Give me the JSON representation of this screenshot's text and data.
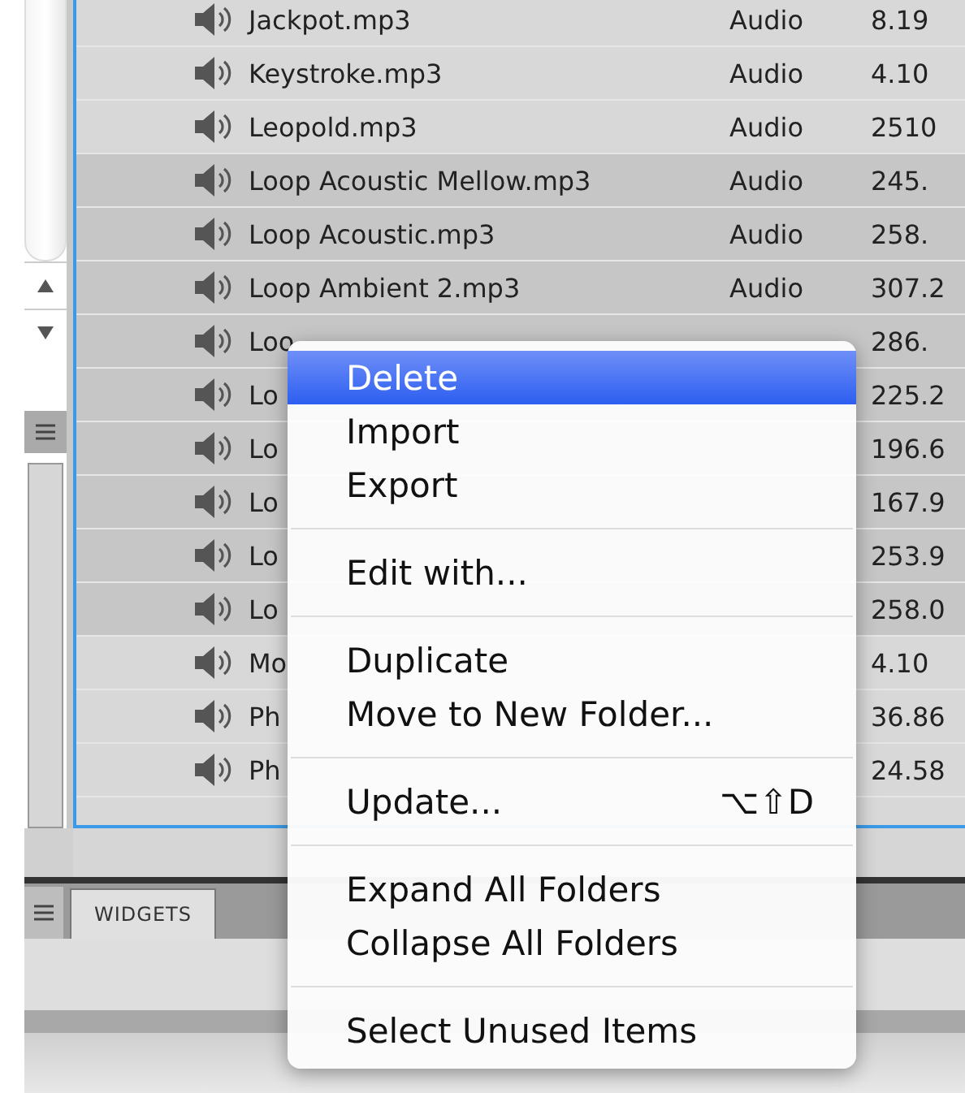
{
  "files": [
    {
      "name": "Jackpot.mp3",
      "type": "Audio",
      "size": "8.19",
      "selected": false
    },
    {
      "name": "Keystroke.mp3",
      "type": "Audio",
      "size": "4.10",
      "selected": false
    },
    {
      "name": "Leopold.mp3",
      "type": "Audio",
      "size": "2510",
      "selected": false
    },
    {
      "name": "Loop Acoustic Mellow.mp3",
      "type": "Audio",
      "size": "245.",
      "selected": true
    },
    {
      "name": "Loop Acoustic.mp3",
      "type": "Audio",
      "size": "258.",
      "selected": true
    },
    {
      "name": "Loop Ambient 2.mp3",
      "type": "Audio",
      "size": "307.2",
      "selected": true
    },
    {
      "name": "Loo",
      "size": "286.",
      "selected": true
    },
    {
      "name": "Lo",
      "size": "225.2",
      "selected": true
    },
    {
      "name": "Lo",
      "size": "196.6",
      "selected": true
    },
    {
      "name": "Lo",
      "size": "167.9",
      "selected": true
    },
    {
      "name": "Lo",
      "size": "253.9",
      "selected": true
    },
    {
      "name": "Lo",
      "size": "258.0",
      "selected": true
    },
    {
      "name": "Mo",
      "size": "4.10",
      "selected": false
    },
    {
      "name": "Ph",
      "size": "36.86",
      "selected": false
    },
    {
      "name": "Ph",
      "size": "24.58",
      "selected": false
    }
  ],
  "context_menu": [
    {
      "kind": "item",
      "label": "Delete",
      "selected": true
    },
    {
      "kind": "item",
      "label": "Import",
      "selected": false
    },
    {
      "kind": "item",
      "label": "Export",
      "selected": false
    },
    {
      "kind": "separator"
    },
    {
      "kind": "item",
      "label": "Edit with...",
      "selected": false
    },
    {
      "kind": "separator"
    },
    {
      "kind": "item",
      "label": "Duplicate",
      "selected": false
    },
    {
      "kind": "item",
      "label": "Move to New Folder...",
      "selected": false
    },
    {
      "kind": "separator"
    },
    {
      "kind": "item",
      "label": "Update...",
      "shortcut": "⌥⇧D",
      "selected": false
    },
    {
      "kind": "separator"
    },
    {
      "kind": "item",
      "label": "Expand All Folders",
      "selected": false
    },
    {
      "kind": "item",
      "label": "Collapse All Folders",
      "selected": false
    },
    {
      "kind": "separator"
    },
    {
      "kind": "item",
      "label": "Select Unused Items",
      "selected": false
    }
  ],
  "bottom_tabs": [
    {
      "label": "WIDGETS",
      "selected": true
    }
  ]
}
